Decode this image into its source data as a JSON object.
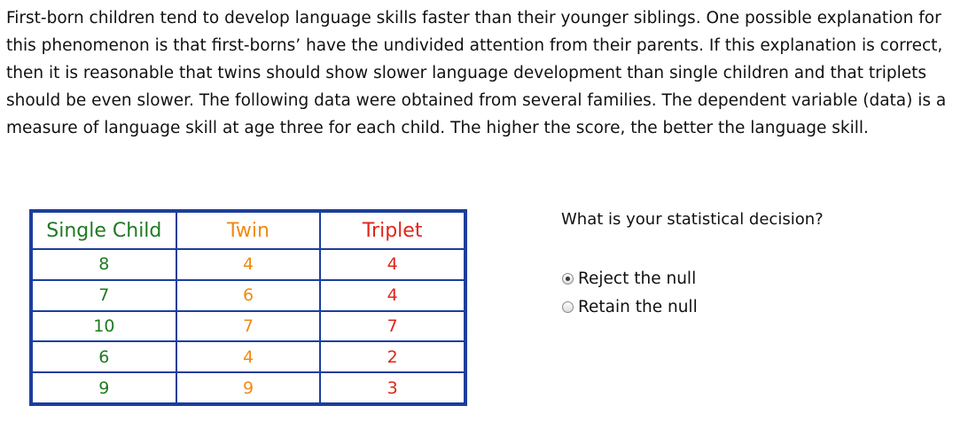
{
  "intro": {
    "paragraph": "First-born children tend to develop language skills faster than their younger siblings. One possible explanation for this phenomenon is that first-borns’ have the undivided attention from their parents. If this explanation is correct, then it is reasonable that twins should show slower language development than single children and that triplets should be even slower. The following data were obtained from several families. The dependent variable (data) is a measure of language skill at age three for each child. The higher the score, the better the language skill."
  },
  "table": {
    "headers": [
      "Single Child",
      "Twin",
      "Triplet"
    ],
    "rows": [
      [
        "8",
        "4",
        "4"
      ],
      [
        "7",
        "6",
        "4"
      ],
      [
        "10",
        "7",
        "7"
      ],
      [
        "6",
        "4",
        "2"
      ],
      [
        "9",
        "9",
        "3"
      ]
    ],
    "colors": {
      "single": "#1f7a22",
      "twin": "#f08a12",
      "triplet": "#e0251b",
      "border": "#1c3e9c"
    }
  },
  "question": {
    "text": "What is your statistical decision?",
    "options": [
      {
        "label": "Reject the null",
        "selected": true
      },
      {
        "label": "Retain the null",
        "selected": false
      }
    ]
  }
}
